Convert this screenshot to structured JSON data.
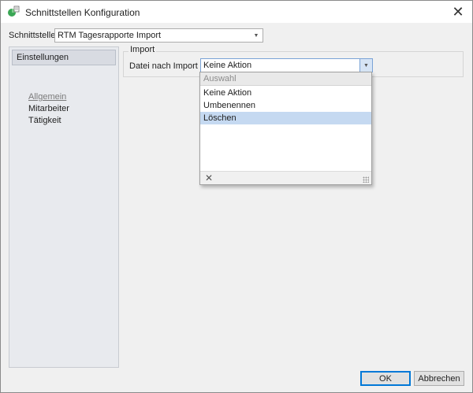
{
  "window": {
    "title": "Schnittstellen Konfiguration"
  },
  "schnittstelle": {
    "label": "Schnittstelle",
    "value": "RTM Tagesrapporte Import"
  },
  "nav": {
    "header": "Einstellungen",
    "items": [
      {
        "label": "Allgemein",
        "active": true
      },
      {
        "label": "Mitarbeiter",
        "active": false
      },
      {
        "label": "Tätigkeit",
        "active": false
      }
    ]
  },
  "import_group": {
    "title": "Import",
    "datei_label": "Datei nach Import",
    "datei_value": "Keine Aktion"
  },
  "dropdown": {
    "header": "Auswahl",
    "options": [
      {
        "label": "Keine Aktion",
        "selected": false
      },
      {
        "label": "Umbenennen",
        "selected": false
      },
      {
        "label": "Löschen",
        "selected": true
      }
    ]
  },
  "buttons": {
    "ok": "OK",
    "cancel": "Abbrechen"
  },
  "colors": {
    "highlight": "#c5d9f1",
    "accent": "#0078d7"
  },
  "icons": [
    "app-icon",
    "close-icon",
    "chevron-down-icon",
    "dropdown-close-icon",
    "resize-grip-icon"
  ]
}
